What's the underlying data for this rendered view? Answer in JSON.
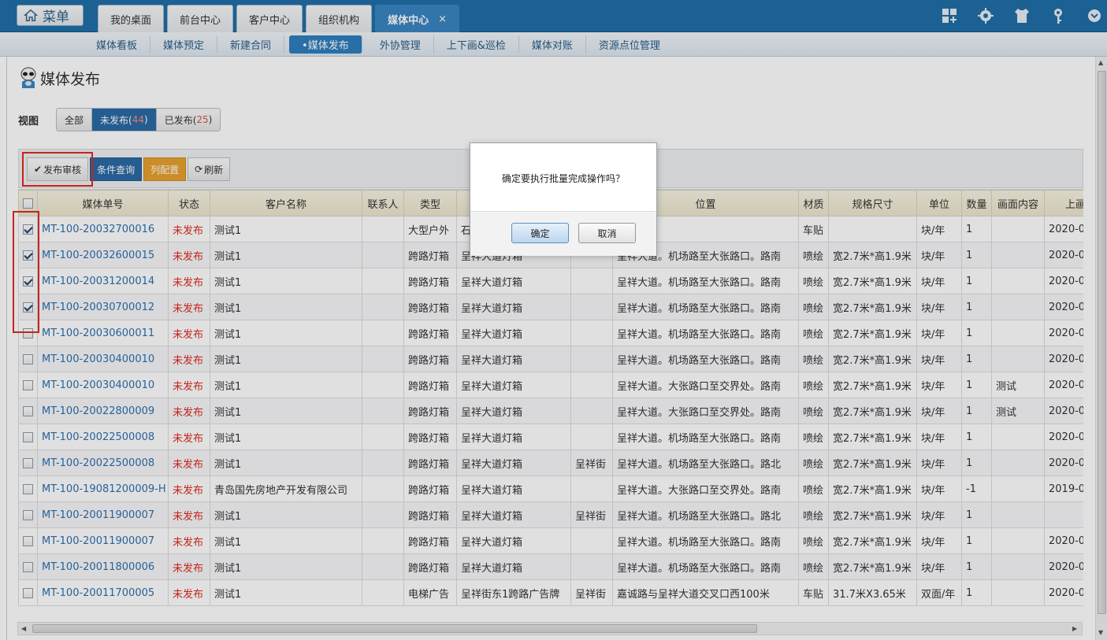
{
  "app": {
    "menu_label": "菜单",
    "nav_tabs": [
      {
        "label": "我的桌面"
      },
      {
        "label": "前台中心"
      },
      {
        "label": "客户中心"
      },
      {
        "label": "组织机构"
      },
      {
        "label": "媒体中心",
        "active": true,
        "close": "×"
      }
    ],
    "top_icons": [
      "grid-add-icon",
      "gear-icon",
      "shirt-icon",
      "key-icon",
      "power-icon"
    ]
  },
  "subnav": {
    "items": [
      {
        "label": "媒体看板"
      },
      {
        "label": "媒体预定"
      },
      {
        "label": "新建合同"
      },
      {
        "label": "•媒体发布",
        "active": true
      },
      {
        "label": "外协管理"
      },
      {
        "label": "上下画&巡检"
      },
      {
        "label": "媒体对账"
      },
      {
        "label": "资源点位管理"
      }
    ]
  },
  "page": {
    "title": "媒体发布",
    "view_label": "视图",
    "views": [
      {
        "label": "全部",
        "count": ""
      },
      {
        "label": "未发布(",
        "count": "44",
        "close": ")",
        "active": true
      },
      {
        "label": "已发布(",
        "count": "25",
        "close": ")"
      }
    ]
  },
  "toolbar": {
    "publish_review": "发布审核",
    "query": "条件查询",
    "columns": "列配置",
    "refresh": "刷新"
  },
  "table": {
    "headers": [
      "媒体单号",
      "状态",
      "客户名称",
      "联系人",
      "类型",
      "",
      "",
      "位置",
      "材质",
      "规格尺寸",
      "单位",
      "数量",
      "画面内容",
      "上画时"
    ],
    "rows": [
      {
        "checked": true,
        "code": "MT-100-20032700016",
        "status": "未发布",
        "customer": "测试1",
        "contact": "",
        "type": "大型户外",
        "name": "石",
        "street": "",
        "location": "",
        "material": "车贴",
        "size": "",
        "unit": "块/年",
        "qty": "1",
        "content": "",
        "date": "2020-0"
      },
      {
        "checked": true,
        "code": "MT-100-20032600015",
        "status": "未发布",
        "customer": "测试1",
        "contact": "",
        "type": "跨路灯箱",
        "name": "呈祥大道灯箱",
        "street": "",
        "location": "呈祥大道。机场路至大张路口。路南",
        "material": "喷绘",
        "size": "宽2.7米*高1.9米",
        "unit": "块/年",
        "qty": "1",
        "content": "",
        "date": "2020-0"
      },
      {
        "checked": true,
        "code": "MT-100-20031200014",
        "status": "未发布",
        "customer": "测试1",
        "contact": "",
        "type": "跨路灯箱",
        "name": "呈祥大道灯箱",
        "street": "",
        "location": "呈祥大道。机场路至大张路口。路南",
        "material": "喷绘",
        "size": "宽2.7米*高1.9米",
        "unit": "块/年",
        "qty": "1",
        "content": "",
        "date": "2020-0"
      },
      {
        "checked": true,
        "code": "MT-100-20030700012",
        "status": "未发布",
        "customer": "测试1",
        "contact": "",
        "type": "跨路灯箱",
        "name": "呈祥大道灯箱",
        "street": "",
        "location": "呈祥大道。机场路至大张路口。路南",
        "material": "喷绘",
        "size": "宽2.7米*高1.9米",
        "unit": "块/年",
        "qty": "1",
        "content": "",
        "date": "2020-0"
      },
      {
        "checked": false,
        "code": "MT-100-20030600011",
        "status": "未发布",
        "customer": "测试1",
        "contact": "",
        "type": "跨路灯箱",
        "name": "呈祥大道灯箱",
        "street": "",
        "location": "呈祥大道。机场路至大张路口。路南",
        "material": "喷绘",
        "size": "宽2.7米*高1.9米",
        "unit": "块/年",
        "qty": "1",
        "content": "",
        "date": "2020-0"
      },
      {
        "checked": false,
        "code": "MT-100-20030400010",
        "status": "未发布",
        "customer": "测试1",
        "contact": "",
        "type": "跨路灯箱",
        "name": "呈祥大道灯箱",
        "street": "",
        "location": "呈祥大道。机场路至大张路口。路南",
        "material": "喷绘",
        "size": "宽2.7米*高1.9米",
        "unit": "块/年",
        "qty": "1",
        "content": "",
        "date": "2020-0"
      },
      {
        "checked": false,
        "code": "MT-100-20030400010",
        "status": "未发布",
        "customer": "测试1",
        "contact": "",
        "type": "跨路灯箱",
        "name": "呈祥大道灯箱",
        "street": "",
        "location": "呈祥大道。大张路口至交界处。路南",
        "material": "喷绘",
        "size": "宽2.7米*高1.9米",
        "unit": "块/年",
        "qty": "1",
        "content": "测试",
        "date": "2020-0"
      },
      {
        "checked": false,
        "code": "MT-100-20022800009",
        "status": "未发布",
        "customer": "测试1",
        "contact": "",
        "type": "跨路灯箱",
        "name": "呈祥大道灯箱",
        "street": "",
        "location": "呈祥大道。大张路口至交界处。路南",
        "material": "喷绘",
        "size": "宽2.7米*高1.9米",
        "unit": "块/年",
        "qty": "1",
        "content": "测试",
        "date": "2020-0"
      },
      {
        "checked": false,
        "code": "MT-100-20022500008",
        "status": "未发布",
        "customer": "测试1",
        "contact": "",
        "type": "跨路灯箱",
        "name": "呈祥大道灯箱",
        "street": "",
        "location": "呈祥大道。机场路至大张路口。路南",
        "material": "喷绘",
        "size": "宽2.7米*高1.9米",
        "unit": "块/年",
        "qty": "1",
        "content": "",
        "date": "2020-0"
      },
      {
        "checked": false,
        "code": "MT-100-20022500008",
        "status": "未发布",
        "customer": "测试1",
        "contact": "",
        "type": "跨路灯箱",
        "name": "呈祥大道灯箱",
        "street": "呈祥街",
        "location": "呈祥大道。机场路至大张路口。路北",
        "material": "喷绘",
        "size": "宽2.7米*高1.9米",
        "unit": "块/年",
        "qty": "1",
        "content": "",
        "date": "2020-0"
      },
      {
        "checked": false,
        "code": "MT-100-19081200009-H",
        "status": "未发布",
        "customer": "青岛国先房地产开发有限公司",
        "contact": "",
        "type": "跨路灯箱",
        "name": "呈祥大道灯箱",
        "street": "",
        "location": "呈祥大道。大张路口至交界处。路南",
        "material": "喷绘",
        "size": "宽2.7米*高1.9米",
        "unit": "块/年",
        "qty": "-1",
        "content": "",
        "date": "2019-0"
      },
      {
        "checked": false,
        "code": "MT-100-20011900007",
        "status": "未发布",
        "customer": "测试1",
        "contact": "",
        "type": "跨路灯箱",
        "name": "呈祥大道灯箱",
        "street": "呈祥街",
        "location": "呈祥大道。机场路至大张路口。路北",
        "material": "喷绘",
        "size": "宽2.7米*高1.9米",
        "unit": "块/年",
        "qty": "1",
        "content": "",
        "date": ""
      },
      {
        "checked": false,
        "code": "MT-100-20011900007",
        "status": "未发布",
        "customer": "测试1",
        "contact": "",
        "type": "跨路灯箱",
        "name": "呈祥大道灯箱",
        "street": "",
        "location": "呈祥大道。机场路至大张路口。路南",
        "material": "喷绘",
        "size": "宽2.7米*高1.9米",
        "unit": "块/年",
        "qty": "1",
        "content": "",
        "date": "2020-0"
      },
      {
        "checked": false,
        "code": "MT-100-20011800006",
        "status": "未发布",
        "customer": "测试1",
        "contact": "",
        "type": "跨路灯箱",
        "name": "呈祥大道灯箱",
        "street": "",
        "location": "呈祥大道。机场路至大张路口。路南",
        "material": "喷绘",
        "size": "宽2.7米*高1.9米",
        "unit": "块/年",
        "qty": "1",
        "content": "",
        "date": "2020-0"
      },
      {
        "checked": false,
        "code": "MT-100-20011700005",
        "status": "未发布",
        "customer": "测试1",
        "contact": "",
        "type": "电梯广告",
        "name": "呈祥街东1跨路广告牌",
        "street": "呈祥街",
        "location": "嘉诚路与呈祥大道交叉口西100米",
        "material": "车贴",
        "size": "31.7米X3.65米",
        "unit": "双面/年",
        "qty": "1",
        "content": "",
        "date": "2020-0"
      }
    ]
  },
  "dialog": {
    "message": "确定要执行批量完成操作吗？",
    "confirm": "确定",
    "cancel": "取消"
  },
  "colors": {
    "topbar": "#1f6fa8",
    "accent_blue": "#2b6aa6",
    "status_red": "#e02a1f",
    "code_blue": "#2d70b0",
    "highlight_red": "#e12b20",
    "orange": "#e7a12e"
  }
}
